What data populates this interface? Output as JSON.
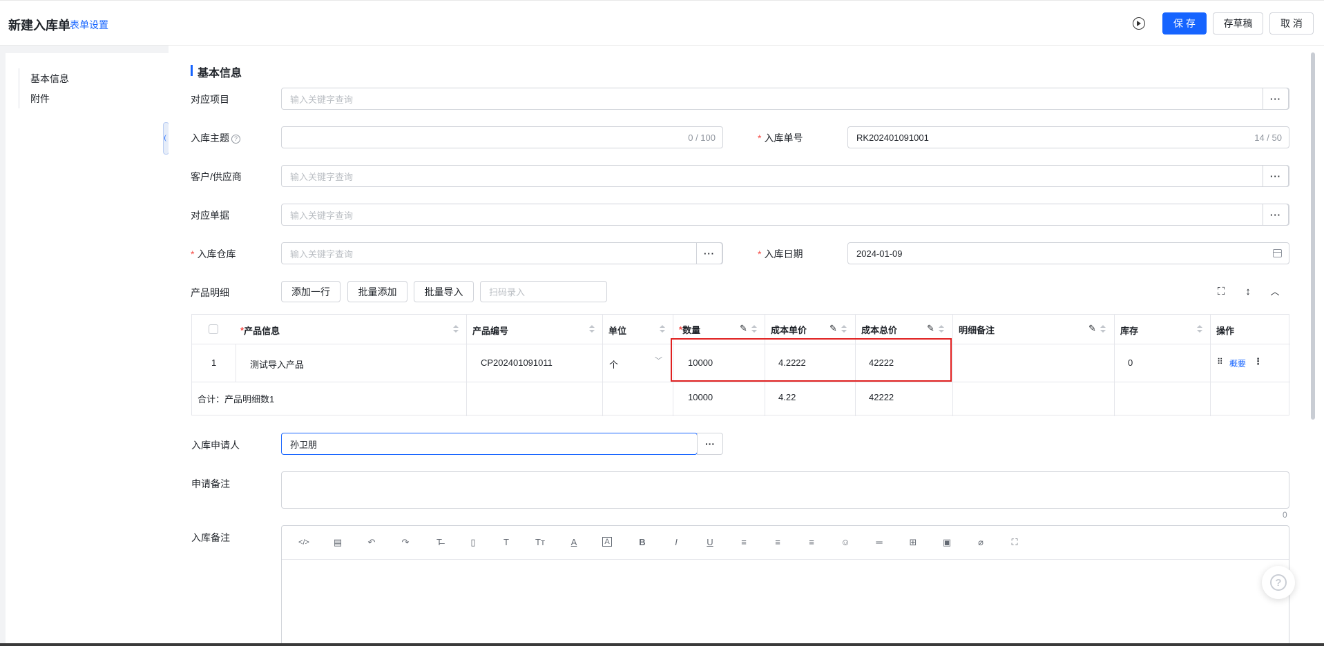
{
  "header": {
    "title": "新建入库单",
    "settings_link": "表单设置",
    "save": "保 存",
    "draft": "存草稿",
    "cancel": "取 消"
  },
  "sidebar": {
    "items": [
      {
        "label": "基本信息"
      },
      {
        "label": "附件"
      }
    ]
  },
  "section": {
    "title": "基本信息"
  },
  "fields": {
    "project": {
      "label": "对应项目",
      "placeholder": "输入关键字查询"
    },
    "subject": {
      "label": "入库主题",
      "value": "",
      "counter": "0 / 100"
    },
    "number": {
      "label": "入库单号",
      "value": "RK202401091001",
      "counter": "14 / 50"
    },
    "customer": {
      "label": "客户/供应商",
      "placeholder": "输入关键字查询"
    },
    "document": {
      "label": "对应单据",
      "placeholder": "输入关键字查询"
    },
    "warehouse": {
      "label": "入库仓库",
      "placeholder": "输入关键字查询"
    },
    "date": {
      "label": "入库日期",
      "value": "2024-01-09"
    },
    "applicant": {
      "label": "入库申请人",
      "value": "孙卫朋"
    },
    "apply_note": {
      "label": "申请备注",
      "counter": "0"
    },
    "stock_note": {
      "label": "入库备注"
    }
  },
  "more_label": "···",
  "products": {
    "label": "产品明细",
    "buttons": {
      "add_row": "添加一行",
      "batch_add": "批量添加",
      "batch_import": "批量导入"
    },
    "scan_placeholder": "扫码录入",
    "columns": [
      "产品信息",
      "产品编号",
      "单位",
      "数量",
      "成本单价",
      "成本总价",
      "明细备注",
      "库存",
      "操作"
    ],
    "rows": [
      {
        "index": "1",
        "name": "测试导入产品",
        "code": "CP202401091011",
        "unit": "个",
        "qty": "10000",
        "unit_price": "4.2222",
        "total": "42222",
        "note": "",
        "stock": "0",
        "action": "概要"
      }
    ],
    "summary": {
      "label": "合计：产品明细数1",
      "qty": "10000",
      "unit_price": "4.22",
      "total": "42222"
    }
  },
  "editor_tools": [
    "code-icon",
    "template-icon",
    "undo-icon",
    "redo-icon",
    "strikethrough-icon",
    "document-icon",
    "font-size-icon",
    "clear-format-icon",
    "font-color-icon",
    "background-color-icon",
    "bold-icon",
    "italic-icon",
    "underline-icon",
    "align-left-icon",
    "align-center-icon",
    "align-right-icon",
    "emoji-icon",
    "divider-icon",
    "table-icon",
    "image-icon",
    "attachment-icon",
    "fullscreen-icon"
  ],
  "editor_glyphs": {
    "code": "</>",
    "template": "▤",
    "undo": "↶",
    "redo": "↷",
    "strike": "T̶",
    "doc": "▯",
    "font_size": "T",
    "clear": "Tт",
    "color": "A",
    "bg": "A",
    "bold": "B",
    "italic": "I",
    "underline": "U",
    "left": "≡",
    "center": "≡",
    "right": "≡",
    "emoji": "☺",
    "divider": "═",
    "table": "⊞",
    "image": "▣",
    "attach": "⌀",
    "full": "⛶"
  },
  "colors": {
    "primary": "#1664ff",
    "required": "#f54a45",
    "highlight": "#e02020"
  }
}
